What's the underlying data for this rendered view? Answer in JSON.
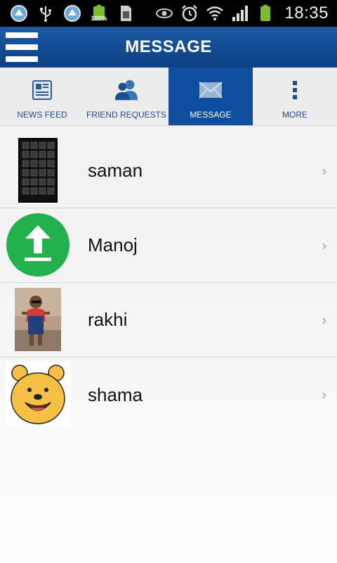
{
  "status_bar": {
    "time": "18:35",
    "battery_percent": "100%",
    "icons": [
      "browser-icon",
      "usb-icon",
      "browser-icon",
      "battery-full-icon",
      "sd-card-icon",
      "eye-icon",
      "alarm-icon",
      "wifi-icon",
      "signal-icon",
      "battery-icon"
    ]
  },
  "header": {
    "title": "MESSAGE"
  },
  "tabs": [
    {
      "label": "NEWS FEED",
      "icon": "newspaper-icon",
      "active": false
    },
    {
      "label": "FRIEND REQUESTS",
      "icon": "friends-icon",
      "active": false
    },
    {
      "label": "MESSAGE",
      "icon": "envelope-icon",
      "active": true
    },
    {
      "label": "MORE",
      "icon": "more-vertical-icon",
      "active": false
    }
  ],
  "conversations": [
    {
      "name": "saman",
      "avatar": "keyboard-photo"
    },
    {
      "name": "Manoj",
      "avatar": "upload-icon"
    },
    {
      "name": "rakhi",
      "avatar": "child-photo"
    },
    {
      "name": "shama",
      "avatar": "pooh-bear-image"
    }
  ],
  "colors": {
    "header_bg": "#0b3f82",
    "tab_active_bg": "#0d4f9e",
    "tab_label": "#1f4d8c",
    "upload_green": "#22b14c"
  }
}
